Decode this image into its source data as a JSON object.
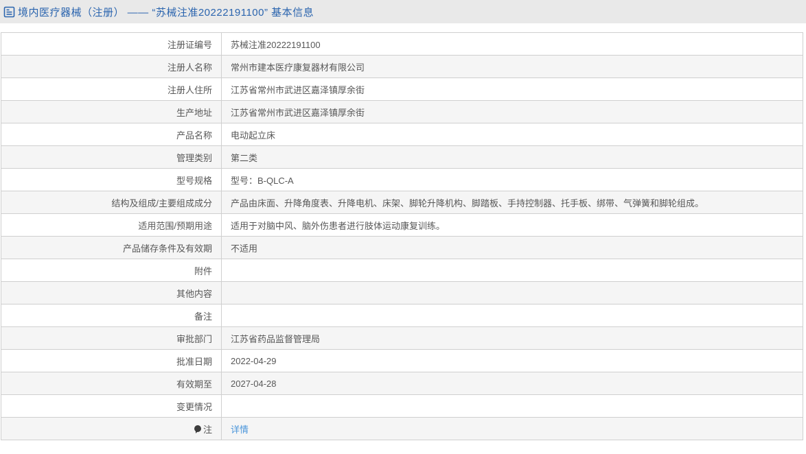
{
  "header": {
    "title": "境内医疗器械（注册） —— “苏械注准20222191100” 基本信息"
  },
  "colors": {
    "title_bar_bg": "#e9e9e9",
    "title_text": "#2a64ae",
    "row_alt_bg": "#f5f5f5",
    "table_border": "#cfcfcf",
    "body_text": "#575757",
    "link": "#4a95da"
  },
  "icons": {
    "title_icon": "document-icon",
    "note_icon": "bulb-icon"
  },
  "table": {
    "rows": [
      {
        "label": "注册证编号",
        "value": "苏械注准20222191100"
      },
      {
        "label": "注册人名称",
        "value": "常州市建本医疗康复器材有限公司"
      },
      {
        "label": "注册人住所",
        "value": "江苏省常州市武进区嘉泽镇厚余街"
      },
      {
        "label": "生产地址",
        "value": "江苏省常州市武进区嘉泽镇厚余街"
      },
      {
        "label": "产品名称",
        "value": "电动起立床"
      },
      {
        "label": "管理类别",
        "value": "第二类"
      },
      {
        "label": "型号规格",
        "value": "型号：B-QLC-A"
      },
      {
        "label": "结构及组成/主要组成成分",
        "value": "产品由床面、升降角度表、升降电机、床架、脚轮升降机构、脚踏板、手持控制器、托手板、绑带、气弹簧和脚轮组成。"
      },
      {
        "label": "适用范围/预期用途",
        "value": "适用于对脑中风、脑外伤患者进行肢体运动康复训练。"
      },
      {
        "label": "产品储存条件及有效期",
        "value": "不适用"
      },
      {
        "label": "附件",
        "value": ""
      },
      {
        "label": "其他内容",
        "value": ""
      },
      {
        "label": "备注",
        "value": ""
      },
      {
        "label": "审批部门",
        "value": "江苏省药品监督管理局"
      },
      {
        "label": "批准日期",
        "value": "2022-04-29"
      },
      {
        "label": "有效期至",
        "value": "2027-04-28"
      },
      {
        "label": "变更情况",
        "value": ""
      },
      {
        "label": "注",
        "value": "详情"
      }
    ]
  }
}
